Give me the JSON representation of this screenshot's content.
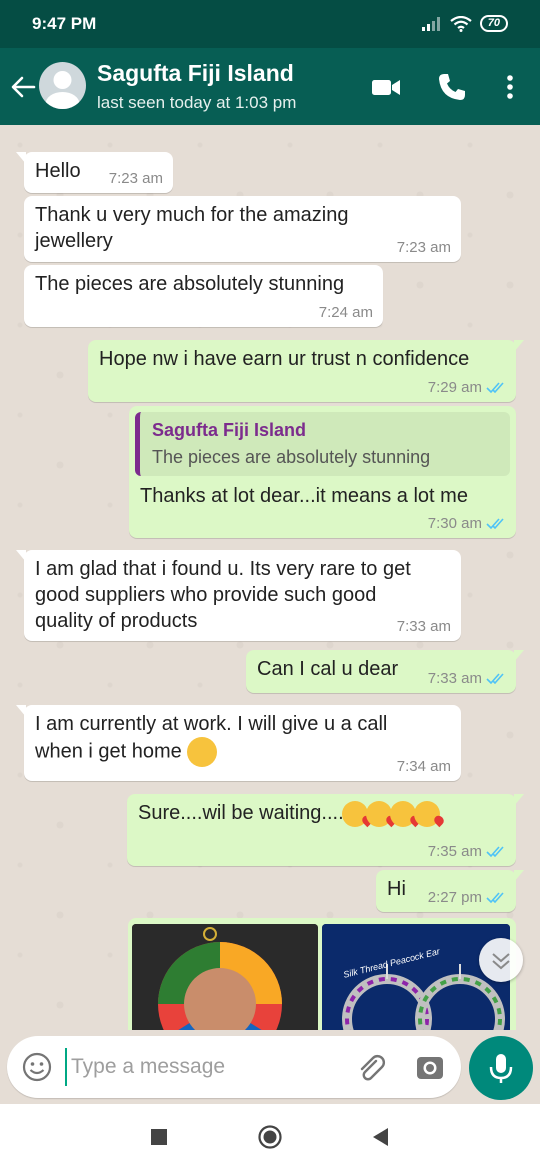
{
  "status_bar": {
    "time": "9:47 PM",
    "battery": "70"
  },
  "header": {
    "contact_name": "Sagufta Fiji Island",
    "last_seen": "last seen today at 1:03 pm"
  },
  "messages": [
    {
      "text": "Hello",
      "time": "7:23 am"
    },
    {
      "text": "Thank u very much for the amazing\njewellery",
      "time": "7:23 am"
    },
    {
      "text": "The pieces are absolutely stunning",
      "time": "7:24 am"
    },
    {
      "text": "Hope nw i have earn ur trust n confidence",
      "time": "7:29 am"
    },
    {
      "quote_name": "Sagufta Fiji Island",
      "quote_text": "The pieces are absolutely stunning",
      "text": "Thanks at lot dear...it means a lot me",
      "time": "7:30 am"
    },
    {
      "text": "I am glad that i found u. Its very rare to get\ngood suppliers who provide such good\nquality of products",
      "time": "7:33 am"
    },
    {
      "text": "Can I cal u dear",
      "time": "7:33 am"
    },
    {
      "text": "I am currently at work. I will give u a call\nwhen i get home",
      "time": "7:34 am"
    },
    {
      "text": "Sure....wil be waiting....",
      "time": "7:35 am"
    },
    {
      "text": "Hi",
      "time": "2:27 pm"
    }
  ],
  "photo_caption": "Silk Thread Peacock Ear",
  "composer": {
    "placeholder": "Type a message"
  },
  "colors": {
    "header": "#075e54",
    "status_bar": "#054d44",
    "outgoing_bubble": "#dcf8c6",
    "incoming_bubble": "#ffffff",
    "read_ticks": "#4fc3f7",
    "accent": "#00897b"
  },
  "icons": [
    "back-arrow-icon",
    "video-call-icon",
    "phone-icon",
    "more-options-icon",
    "emoji-icon",
    "attach-icon",
    "camera-icon",
    "mic-icon",
    "scroll-down-icon"
  ]
}
